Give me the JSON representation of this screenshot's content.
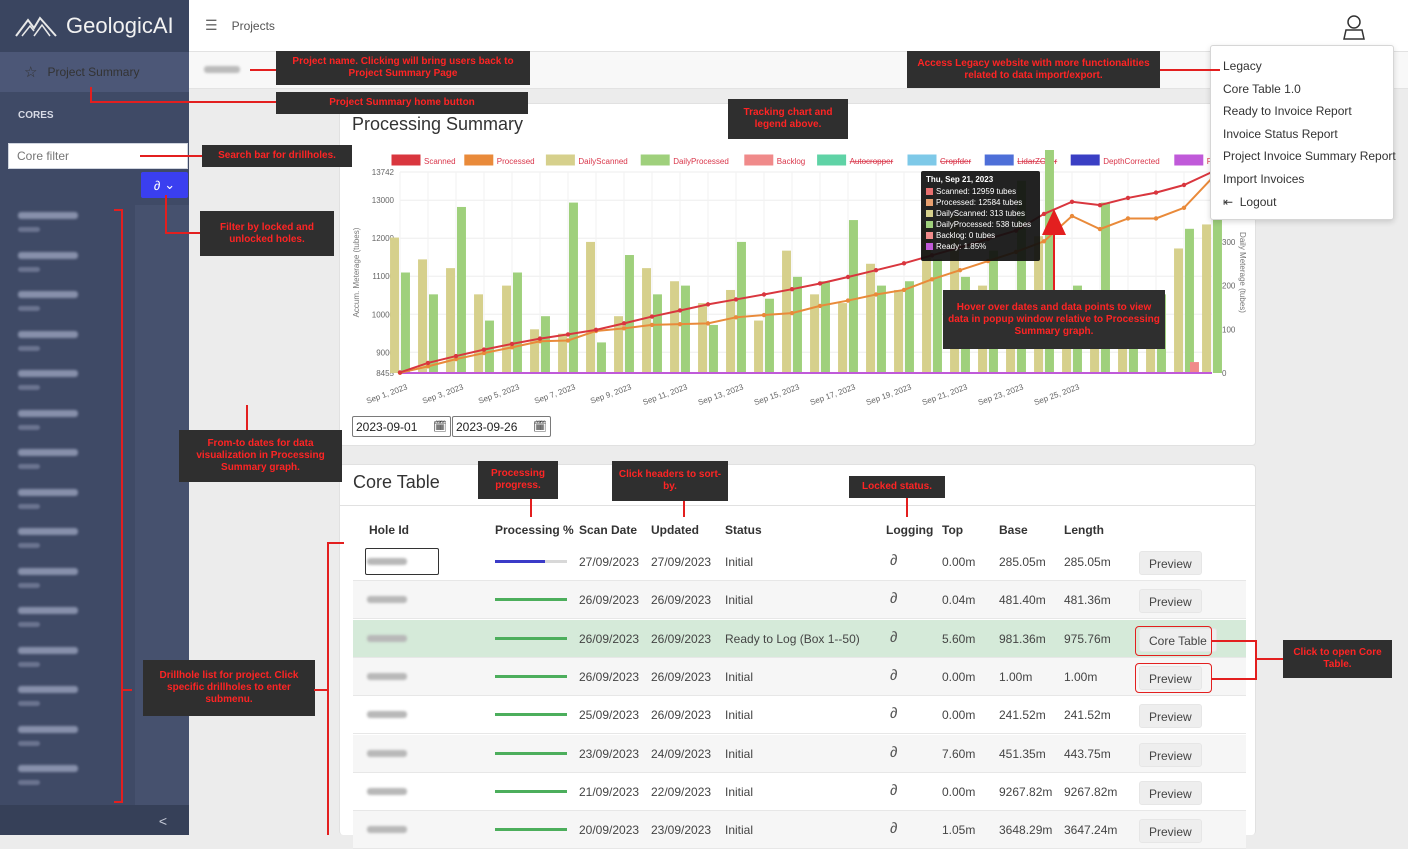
{
  "app": {
    "name": "GeologicAI",
    "logo_icon": "mountain-logo-icon"
  },
  "topbar": {
    "breadcrumb": "Projects",
    "menu_icon": "hamburger-icon",
    "user_icon": "user-icon"
  },
  "sidebar": {
    "project_summary_label": "Project Summary",
    "cores_label": "CORES",
    "core_filter_placeholder": "Core filter",
    "filter_icons": [
      "lock-icon",
      "chevron-down-icon"
    ],
    "hole_count": 15,
    "collapse_glyph": "<"
  },
  "user_menu": {
    "items": [
      "Legacy",
      "Core Table 1.0",
      "Ready to Invoice Report",
      "Invoice Status Report",
      "Project Invoice Summary Report",
      "Import Invoices"
    ],
    "logout": "Logout"
  },
  "processing": {
    "title": "Processing Summary",
    "from_date": "2023-09-01",
    "to_date": "2023-09-26"
  },
  "chart_data": {
    "type": "bar",
    "legend": [
      "Scanned",
      "Processed",
      "DailyScanned",
      "DailyProcessed",
      "Backlog",
      "Autocropper",
      "Cropfder",
      "LidarZOver",
      "DepthCorrected",
      "Ready"
    ],
    "legend_colors": [
      "#d9363e",
      "#e98a3a",
      "#d6d08c",
      "#9fd07c",
      "#f08a8a",
      "#5fd3a6",
      "#7ec9e8",
      "#4e6fd8",
      "#3a3fc4",
      "#c05ad9"
    ],
    "x_ticks": [
      "Sep 1, 2023",
      "Sep 3, 2023",
      "Sep 5, 2023",
      "Sep 7, 2023",
      "Sep 9, 2023",
      "Sep 11, 2023",
      "Sep 13, 2023",
      "Sep 15, 2023",
      "Sep 17, 2023",
      "Sep 19, 2023",
      "Sep 21, 2023",
      "Sep 23, 2023",
      "Sep 25, 2023"
    ],
    "y_left_ticks": [
      8455,
      9000,
      10000,
      11000,
      12000,
      13000,
      13742
    ],
    "y_left_label": "Accum. Meterage (tubes)",
    "y_left_range": [
      8455,
      13742
    ],
    "y_right_ticks": [
      0,
      100,
      200,
      300,
      400
    ],
    "y_right_label": "Daily Meterage (tubes)",
    "y_right_range": [
      0,
      460
    ],
    "scanned": [
      8470,
      8720,
      8900,
      9070,
      9220,
      9360,
      9470,
      9590,
      9760,
      9940,
      10100,
      10260,
      10390,
      10520,
      10660,
      10810,
      10980,
      11160,
      11340,
      11550,
      11760,
      11980,
      12200,
      12640,
      12959,
      12870,
      13060,
      13200,
      13400,
      13742
    ],
    "processed": [
      8460,
      8630,
      8820,
      8980,
      9130,
      9290,
      9310,
      9560,
      9630,
      9720,
      9740,
      9760,
      9920,
      9980,
      10030,
      10220,
      10360,
      10520,
      10640,
      10920,
      11160,
      11400,
      11640,
      11920,
      12584,
      12240,
      12520,
      12520,
      12800,
      13580
    ],
    "daily_scanned": [
      310,
      260,
      240,
      180,
      200,
      100,
      90,
      300,
      130,
      240,
      210,
      160,
      190,
      120,
      280,
      180,
      160,
      250,
      190,
      340,
      360,
      200,
      140,
      313,
      130,
      100,
      160,
      150,
      285,
      340
    ],
    "daily_processed": [
      230,
      180,
      380,
      120,
      230,
      130,
      390,
      70,
      270,
      180,
      200,
      110,
      300,
      170,
      220,
      210,
      350,
      200,
      210,
      260,
      220,
      280,
      440,
      538,
      200,
      390,
      180,
      180,
      330,
      370
    ],
    "backlog_last": 25,
    "tooltip": {
      "title": "Thu, Sep 21, 2023",
      "rows": [
        "Scanned: 12959 tubes",
        "Processed: 12584 tubes",
        "DailyScanned: 313 tubes",
        "DailyProcessed: 538 tubes",
        "Backlog: 0 tubes",
        "Ready: 1.85%"
      ]
    }
  },
  "core_table": {
    "title": "Core Table",
    "headers": [
      "Hole Id",
      "Processing %",
      "Scan Date",
      "Updated",
      "Status",
      "Logging",
      "Top",
      "Base",
      "Length"
    ],
    "rows": [
      {
        "progress": 0.7,
        "progress_color": "#3b3bc8",
        "scan": "27/09/2023",
        "updated": "27/09/2023",
        "status": "Initial",
        "top": "0.00m",
        "base": "285.05m",
        "length": "285.05m",
        "action": "Preview"
      },
      {
        "progress": 1,
        "progress_color": "#4cae5c",
        "scan": "26/09/2023",
        "updated": "26/09/2023",
        "status": "Initial",
        "top": "0.04m",
        "base": "481.40m",
        "length": "481.36m",
        "action": "Preview"
      },
      {
        "progress": 1,
        "progress_color": "#4cae5c",
        "scan": "26/09/2023",
        "updated": "26/09/2023",
        "status": "Ready to Log (Box 1--50)",
        "top": "5.60m",
        "base": "981.36m",
        "length": "975.76m",
        "action": "Core Table"
      },
      {
        "progress": 1,
        "progress_color": "#4cae5c",
        "scan": "26/09/2023",
        "updated": "26/09/2023",
        "status": "Initial",
        "top": "0.00m",
        "base": "1.00m",
        "length": "1.00m",
        "action": "Preview"
      },
      {
        "progress": 1,
        "progress_color": "#4cae5c",
        "scan": "25/09/2023",
        "updated": "26/09/2023",
        "status": "Initial",
        "top": "0.00m",
        "base": "241.52m",
        "length": "241.52m",
        "action": "Preview"
      },
      {
        "progress": 1,
        "progress_color": "#4cae5c",
        "scan": "23/09/2023",
        "updated": "24/09/2023",
        "status": "Initial",
        "top": "7.60m",
        "base": "451.35m",
        "length": "443.75m",
        "action": "Preview"
      },
      {
        "progress": 1,
        "progress_color": "#4cae5c",
        "scan": "21/09/2023",
        "updated": "22/09/2023",
        "status": "Initial",
        "top": "0.00m",
        "base": "9267.82m",
        "length": "9267.82m",
        "action": "Preview"
      },
      {
        "progress": 1,
        "progress_color": "#4cae5c",
        "scan": "20/09/2023",
        "updated": "23/09/2023",
        "status": "Initial",
        "top": "1.05m",
        "base": "3648.29m",
        "length": "3647.24m",
        "action": "Preview"
      }
    ]
  },
  "annotations": [
    "Project name. Clicking will bring users back to  Project Summary Page",
    "Project Summary home button",
    "Search bar for drillholes.",
    "Filter by locked and unlocked holes.",
    "Tracking chart and legend above.",
    "Access Legacy website with more functionalities related to data import/export.",
    "Hover over dates and data points to view data  in popup window relative to Processing Summary graph.",
    "From-to dates for data visualization in Processing Summary graph.",
    "Processing progress.",
    "Click headers to sort-by.",
    "Locked status.",
    "Click to open Core Table.",
    "Drillhole list for project. Click specific drillholes to enter submenu."
  ]
}
